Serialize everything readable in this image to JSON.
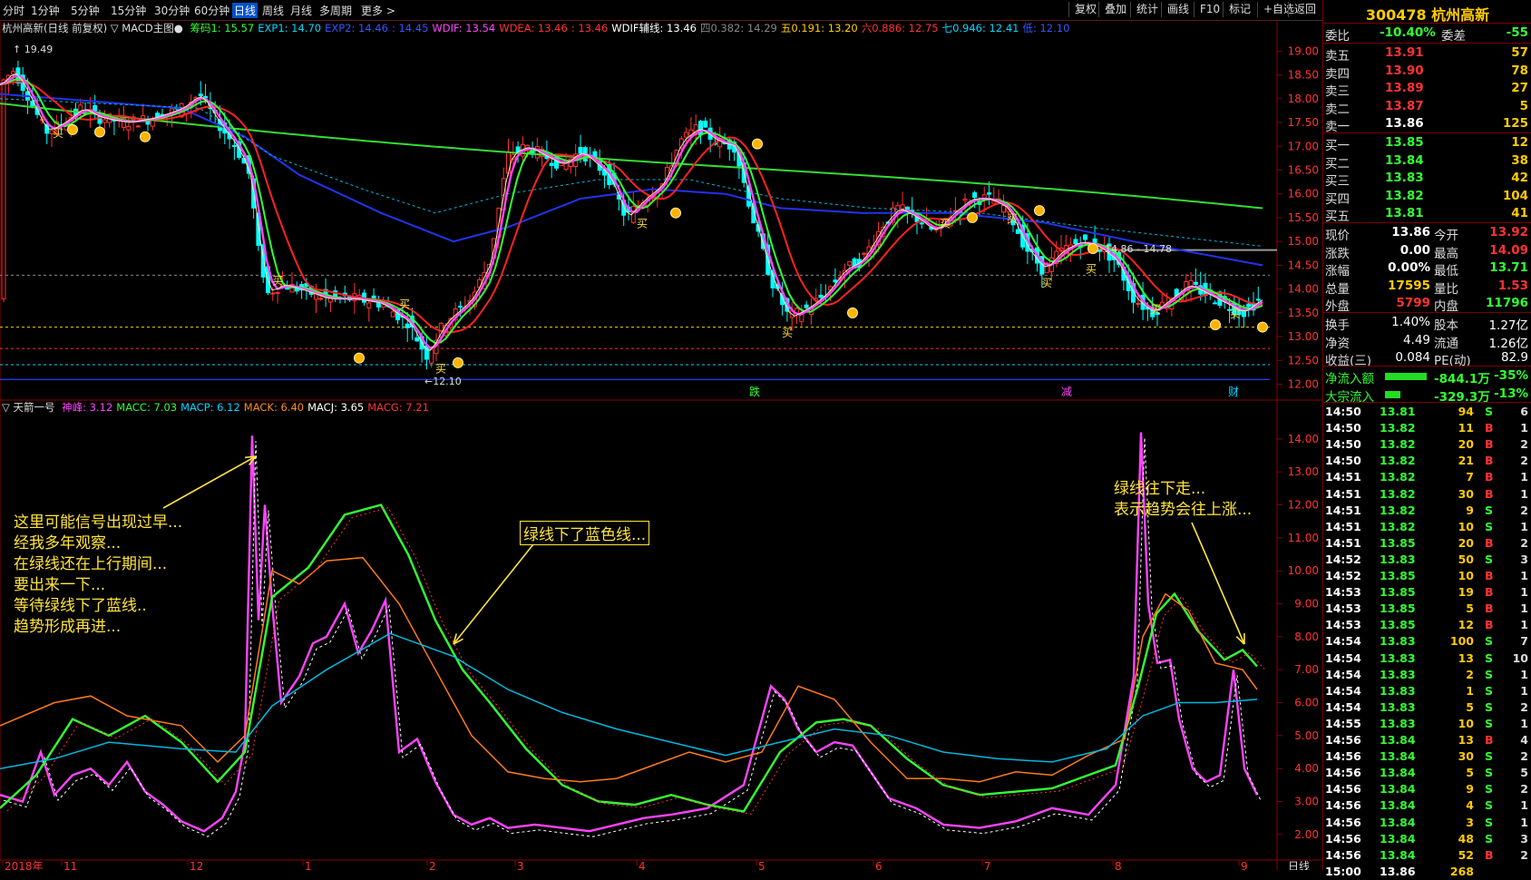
{
  "toolbar": {
    "periods": [
      "分时",
      "1分钟",
      "5分钟",
      "15分钟",
      "30分钟",
      "60分钟",
      "日线",
      "周线",
      "月线",
      "多周期",
      "更多 >"
    ],
    "active_period": "日线",
    "right_buttons": [
      "复权",
      "叠加",
      "统计",
      "画线",
      "F10",
      "标记",
      "+自选",
      "返回"
    ]
  },
  "main_legend": {
    "title": "杭州高新(日线 前复权) ▽ MACD主图●",
    "items": [
      {
        "text": "筹码1: 15.57",
        "color": "#33ff33"
      },
      {
        "text": "EXP1: 14.70",
        "color": "#00d8ff"
      },
      {
        "text": "EXP2: 14.46",
        "color": "#3355ff"
      },
      {
        "text": ": 14.45",
        "color": "#3355ff"
      },
      {
        "text": "WDIF: 13.54",
        "color": "#ff44ff"
      },
      {
        "text": "WDEA: 13.46",
        "color": "#ff3333"
      },
      {
        "text": ": 13.46",
        "color": "#ff3333"
      },
      {
        "text": "WDIF辅线: 13.46",
        "color": "#ffffff"
      },
      {
        "text": "四0.382: 14.29",
        "color": "#888888"
      },
      {
        "text": "五0.191: 13.20",
        "color": "#ffcc00"
      },
      {
        "text": "六0.886: 12.75",
        "color": "#ff3333"
      },
      {
        "text": "七0.946: 12.41",
        "color": "#00d8ff"
      },
      {
        "text": "低: 12.10",
        "color": "#3355ff"
      }
    ]
  },
  "sub_legend": {
    "title": "▽ 天箭一号",
    "items": [
      {
        "text": "神峰: 3.12",
        "color": "#ff44ff"
      },
      {
        "text": "MACC: 7.03",
        "color": "#33ff33"
      },
      {
        "text": "MACP: 6.12",
        "color": "#00d8ff"
      },
      {
        "text": "MACK: 6.40",
        "color": "#ff8c1a"
      },
      {
        "text": "MACJ: 3.65",
        "color": "#ffffff"
      },
      {
        "text": "MACG: 7.21",
        "color": "#ff3333"
      }
    ]
  },
  "main_axis": [
    "19.00",
    "18.50",
    "18.00",
    "17.50",
    "17.00",
    "16.50",
    "16.00",
    "15.50",
    "15.00",
    "14.50",
    "14.00",
    "13.50",
    "13.00",
    "12.50",
    "12.00"
  ],
  "sub_axis": [
    "14.00",
    "13.00",
    "12.00",
    "11.00",
    "10.00",
    "9.00",
    "8.00",
    "7.00",
    "6.00",
    "5.00",
    "4.00",
    "3.00",
    "2.00"
  ],
  "time_axis": [
    "2018年",
    "11",
    "12",
    "1",
    "2",
    "3",
    "4",
    "5",
    "6",
    "7",
    "8",
    "9"
  ],
  "period_footer": "日线",
  "price_marks": {
    "high": "19.49",
    "low": "12.10",
    "range": "14.86 - 14.78"
  },
  "signal_labels": {
    "buy": "买",
    "events": [
      "跌",
      "减",
      "财"
    ]
  },
  "annotations": {
    "left_lines": [
      "这里可能信号出现过早...",
      "经我多年观察...",
      "在绿线还在上行期间...",
      "要出来一下...",
      "等待绿线下了蓝线..",
      "趋势形成再进..."
    ],
    "middle_box": "绿线下了蓝色线...",
    "right_lines": [
      "绿线往下走...",
      "表示趋势会往上涨..."
    ]
  },
  "quote": {
    "code_name": "300478 杭州高新",
    "webi": {
      "label": "委比",
      "value": "-10.40%",
      "label2": "委差",
      "value2": "-55"
    },
    "asks": [
      {
        "label": "卖五",
        "price": "13.91",
        "vol": "57"
      },
      {
        "label": "卖四",
        "price": "13.90",
        "vol": "78"
      },
      {
        "label": "卖三",
        "price": "13.89",
        "vol": "27"
      },
      {
        "label": "卖二",
        "price": "13.87",
        "vol": "5"
      },
      {
        "label": "卖一",
        "price": "13.86",
        "vol": "125"
      }
    ],
    "bids": [
      {
        "label": "买一",
        "price": "13.85",
        "vol": "12"
      },
      {
        "label": "买二",
        "price": "13.84",
        "vol": "38"
      },
      {
        "label": "买三",
        "price": "13.83",
        "vol": "42"
      },
      {
        "label": "买四",
        "price": "13.82",
        "vol": "104"
      },
      {
        "label": "买五",
        "price": "13.81",
        "vol": "41"
      }
    ],
    "stats": [
      {
        "l1": "现价",
        "v1": "13.86",
        "c1": "#ffffff",
        "l2": "今开",
        "v2": "13.92",
        "c2": "#ff3333"
      },
      {
        "l1": "涨跌",
        "v1": "0.00",
        "c1": "#ffffff",
        "l2": "最高",
        "v2": "14.09",
        "c2": "#ff3333"
      },
      {
        "l1": "涨幅",
        "v1": "0.00%",
        "c1": "#ffffff",
        "l2": "最低",
        "v2": "13.71",
        "c2": "#33ff33"
      },
      {
        "l1": "总量",
        "v1": "17595",
        "c1": "#ffcc00",
        "l2": "量比",
        "v2": "1.53",
        "c2": "#ff3333"
      },
      {
        "l1": "外盘",
        "v1": "5799",
        "c1": "#ff3333",
        "l2": "内盘",
        "v2": "11796",
        "c2": "#33ff33"
      }
    ],
    "stats2": [
      {
        "l1": "换手",
        "v1": "1.40%",
        "l2": "股本",
        "v2": "1.27亿"
      },
      {
        "l1": "净资",
        "v1": "4.49",
        "l2": "流通",
        "v2": "1.26亿"
      },
      {
        "l1": "收益(三)",
        "v1": "0.084",
        "l2": "PE(动)",
        "v2": "82.9"
      }
    ],
    "flows": [
      {
        "label": "净流入额",
        "value": "-844.1万",
        "pct": "-35%",
        "bar": 0.35
      },
      {
        "label": "大宗流入",
        "value": "-329.3万",
        "pct": "-13%",
        "bar": 0.13
      }
    ],
    "ticks": [
      [
        "14:50",
        "13.81",
        "94",
        "S",
        "6"
      ],
      [
        "14:50",
        "13.82",
        "11",
        "B",
        "1"
      ],
      [
        "14:50",
        "13.82",
        "20",
        "B",
        "2"
      ],
      [
        "14:50",
        "13.82",
        "21",
        "B",
        "2"
      ],
      [
        "14:51",
        "13.82",
        "7",
        "B",
        "1"
      ],
      [
        "14:51",
        "13.82",
        "30",
        "B",
        "1"
      ],
      [
        "14:51",
        "13.82",
        "9",
        "S",
        "2"
      ],
      [
        "14:51",
        "13.82",
        "10",
        "S",
        "1"
      ],
      [
        "14:51",
        "13.85",
        "20",
        "B",
        "2"
      ],
      [
        "14:52",
        "13.83",
        "50",
        "S",
        "3"
      ],
      [
        "14:52",
        "13.85",
        "10",
        "B",
        "1"
      ],
      [
        "14:53",
        "13.85",
        "19",
        "B",
        "1"
      ],
      [
        "14:53",
        "13.85",
        "5",
        "B",
        "1"
      ],
      [
        "14:53",
        "13.85",
        "12",
        "B",
        "1"
      ],
      [
        "14:54",
        "13.83",
        "100",
        "S",
        "7"
      ],
      [
        "14:54",
        "13.83",
        "13",
        "S",
        "10"
      ],
      [
        "14:54",
        "13.83",
        "2",
        "S",
        "1"
      ],
      [
        "14:54",
        "13.83",
        "1",
        "S",
        "1"
      ],
      [
        "14:54",
        "13.83",
        "5",
        "S",
        "2"
      ],
      [
        "14:55",
        "13.83",
        "10",
        "S",
        "1"
      ],
      [
        "14:56",
        "13.84",
        "13",
        "B",
        "4"
      ],
      [
        "14:56",
        "13.84",
        "30",
        "S",
        "2"
      ],
      [
        "14:56",
        "13.84",
        "5",
        "S",
        "5"
      ],
      [
        "14:56",
        "13.84",
        "9",
        "S",
        "2"
      ],
      [
        "14:56",
        "13.84",
        "4",
        "S",
        "1"
      ],
      [
        "14:56",
        "13.84",
        "3",
        "S",
        "1"
      ],
      [
        "14:56",
        "13.84",
        "48",
        "S",
        "3"
      ],
      [
        "14:56",
        "13.84",
        "52",
        "B",
        "2"
      ],
      [
        "15:00",
        "13.86",
        "268",
        "",
        ""
      ]
    ]
  },
  "colors": {
    "up": "#ff3333",
    "down": "#00ffff",
    "green_line": "#33ff33",
    "blue_line": "#2233ff",
    "pink": "#ff44ff",
    "orange": "#ff8c1a",
    "annotation": "#ffe43c"
  }
}
